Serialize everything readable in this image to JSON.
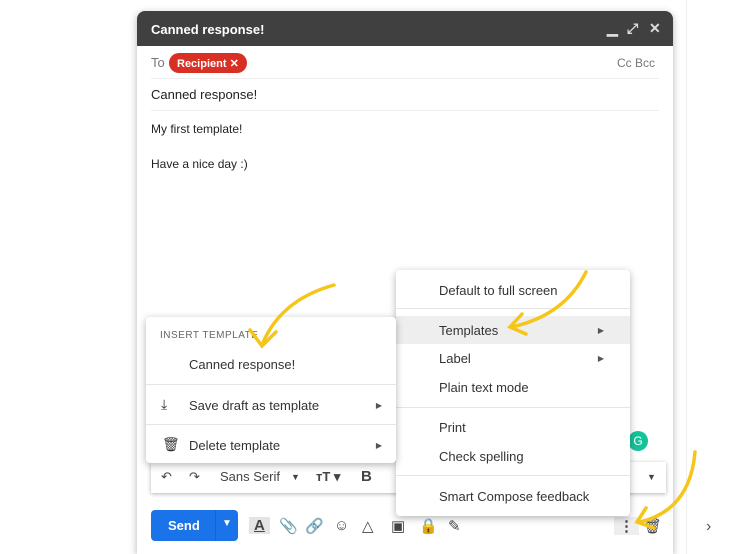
{
  "compose": {
    "title": "Canned response!",
    "to_label": "To",
    "recipient": "Recipient",
    "cc_bcc": "Cc Bcc",
    "subject": "Canned response!",
    "body_lines": [
      "My first template!",
      "Have a nice day :)"
    ]
  },
  "toolbar": {
    "font": "Sans Serif"
  },
  "send": {
    "label": "Send"
  },
  "template_menu": {
    "header": "INSERT TEMPLATE",
    "items": [
      "Canned response!",
      "Save draft as template",
      "Delete template"
    ]
  },
  "more_menu": {
    "items": [
      "Default to full screen",
      "Templates",
      "Label",
      "Plain text mode",
      "Print",
      "Check spelling",
      "Smart Compose feedback"
    ]
  },
  "colors": {
    "send": "#1a73e8",
    "chip": "#d93025",
    "header": "#404040",
    "annotation": "#f5c518"
  }
}
